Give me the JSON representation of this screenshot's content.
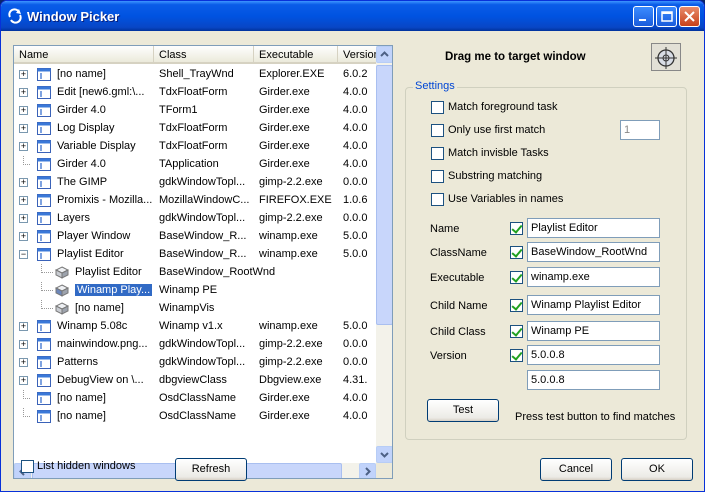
{
  "window": {
    "title": "Window Picker"
  },
  "list": {
    "columns": [
      "Name",
      "Class",
      "Executable",
      "Version"
    ],
    "rows": [
      {
        "level": 0,
        "expander": "+",
        "icon": "window",
        "name": "[no name]",
        "class": "Shell_TrayWnd",
        "exe": "Explorer.EXE",
        "version": "6.0.2"
      },
      {
        "level": 0,
        "expander": "+",
        "icon": "window",
        "name": "Edit [new6.gml:\\...",
        "class": "TdxFloatForm",
        "exe": "Girder.exe",
        "version": "4.0.0"
      },
      {
        "level": 0,
        "expander": "+",
        "icon": "window",
        "name": "Girder 4.0",
        "class": "TForm1",
        "exe": "Girder.exe",
        "version": "4.0.0"
      },
      {
        "level": 0,
        "expander": "+",
        "icon": "window",
        "name": "Log Display",
        "class": "TdxFloatForm",
        "exe": "Girder.exe",
        "version": "4.0.0"
      },
      {
        "level": 0,
        "expander": "+",
        "icon": "window",
        "name": "Variable Display",
        "class": "TdxFloatForm",
        "exe": "Girder.exe",
        "version": "4.0.0"
      },
      {
        "level": 0,
        "expander": "",
        "icon": "window",
        "name": "Girder 4.0",
        "class": "TApplication",
        "exe": "Girder.exe",
        "version": "4.0.0"
      },
      {
        "level": 0,
        "expander": "+",
        "icon": "window",
        "name": "The GIMP",
        "class": "gdkWindowTopl...",
        "exe": "gimp-2.2.exe",
        "version": "0.0.0"
      },
      {
        "level": 0,
        "expander": "+",
        "icon": "window",
        "name": "Promixis - Mozilla...",
        "class": "MozillaWindowC...",
        "exe": "FIREFOX.EXE",
        "version": "1.0.6"
      },
      {
        "level": 0,
        "expander": "+",
        "icon": "window",
        "name": "Layers",
        "class": "gdkWindowTopl...",
        "exe": "gimp-2.2.exe",
        "version": "0.0.0"
      },
      {
        "level": 0,
        "expander": "+",
        "icon": "window",
        "name": "Player Window",
        "class": "BaseWindow_R...",
        "exe": "winamp.exe",
        "version": "5.0.0"
      },
      {
        "level": 0,
        "expander": "−",
        "icon": "window",
        "name": "Playlist Editor",
        "class": "BaseWindow_R...",
        "exe": "winamp.exe",
        "version": "5.0.0"
      },
      {
        "level": 1,
        "expander": "",
        "icon": "cube",
        "name": "Playlist Editor",
        "class": "BaseWindow_RootWnd",
        "exe": "",
        "version": ""
      },
      {
        "level": 1,
        "expander": "",
        "icon": "cube-selected",
        "name": "Winamp Play...",
        "class": "Winamp PE",
        "exe": "",
        "version": "",
        "selected": true
      },
      {
        "level": 1,
        "expander": "",
        "icon": "cube",
        "name": "[no name]",
        "class": "WinampVis",
        "exe": "",
        "version": ""
      },
      {
        "level": 0,
        "expander": "+",
        "icon": "window",
        "name": "Winamp 5.08c",
        "class": "Winamp v1.x",
        "exe": "winamp.exe",
        "version": "5.0.0"
      },
      {
        "level": 0,
        "expander": "+",
        "icon": "window",
        "name": "mainwindow.png...",
        "class": "gdkWindowTopl...",
        "exe": "gimp-2.2.exe",
        "version": "0.0.0"
      },
      {
        "level": 0,
        "expander": "+",
        "icon": "window",
        "name": "Patterns",
        "class": "gdkWindowTopl...",
        "exe": "gimp-2.2.exe",
        "version": "0.0.0"
      },
      {
        "level": 0,
        "expander": "+",
        "icon": "window",
        "name": "DebugView on \\...",
        "class": "dbgviewClass",
        "exe": "Dbgview.exe",
        "version": "4.31."
      },
      {
        "level": 0,
        "expander": "",
        "icon": "window",
        "name": "[no name]",
        "class": "OsdClassName",
        "exe": "Girder.exe",
        "version": "4.0.0"
      },
      {
        "level": 0,
        "expander": "",
        "icon": "window",
        "name": "[no name]",
        "class": "OsdClassName",
        "exe": "Girder.exe",
        "version": "4.0.0"
      }
    ]
  },
  "list_hidden": {
    "label": "List hidden windows",
    "checked": false
  },
  "refresh_label": "Refresh",
  "drag_label": "Drag me to target window",
  "settings": {
    "title": "Settings",
    "options": [
      {
        "label": "Match foreground task",
        "checked": false
      },
      {
        "label": "Only use first match",
        "checked": false
      },
      {
        "label": "Match invisble Tasks",
        "checked": false
      },
      {
        "label": "Substring matching",
        "checked": false
      },
      {
        "label": "Use Variables in names",
        "checked": false
      }
    ],
    "first_match_value": "1",
    "fields": [
      {
        "label": "Name",
        "checked": true,
        "value": "Playlist Editor"
      },
      {
        "label": "ClassName",
        "checked": true,
        "value": "BaseWindow_RootWnd"
      },
      {
        "label": "Executable",
        "checked": true,
        "value": "winamp.exe"
      },
      {
        "label": "Child Name",
        "checked": true,
        "value": "Winamp Playlist Editor"
      },
      {
        "label": "Child Class",
        "checked": true,
        "value": "Winamp PE"
      },
      {
        "label": "Version",
        "checked": true,
        "value": "5.0.0.8"
      }
    ],
    "version_to": "5.0.0.8",
    "test_label": "Test",
    "test_hint": "Press test button to find matches"
  },
  "cancel_label": "Cancel",
  "ok_label": "OK"
}
